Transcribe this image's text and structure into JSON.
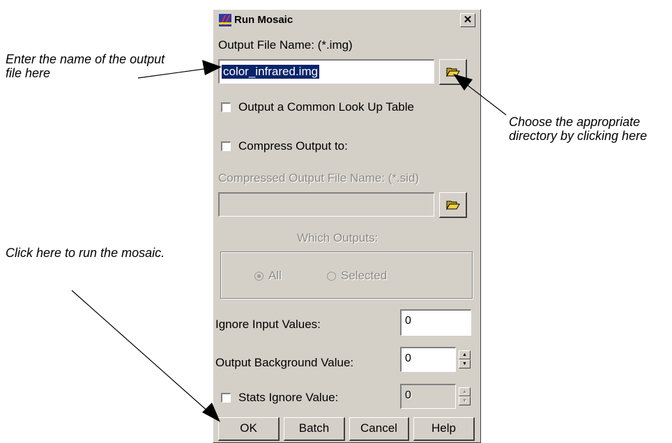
{
  "annotations": {
    "output_file": "Enter the name of the output file here",
    "directory": "Choose the appropriate directory by clicking here",
    "run": "Click here to run the mosaic."
  },
  "dialog": {
    "title": "Run Mosaic",
    "close_label": "✕",
    "output_label": "Output File Name: (*.img)",
    "output_value": "color_infrared.img",
    "common_lut_label": "Output a Common Look Up Table",
    "compress_label": "Compress Output to:",
    "compressed_label": "Compressed Output File Name: (*.sid)",
    "which_outputs_label": "Which Outputs:",
    "radio_all": "All",
    "radio_selected": "Selected",
    "ignore_input_label": "Ignore Input Values:",
    "ignore_input_value": "0",
    "bg_label": "Output Background Value:",
    "bg_value": "0",
    "stats_ignore_label": "Stats Ignore Value:",
    "stats_ignore_value": "0",
    "buttons": {
      "ok": "OK",
      "batch": "Batch",
      "cancel": "Cancel",
      "help": "Help"
    }
  },
  "colors": {
    "dialog_bg": "#d4d0c8",
    "selection": "#0a246a"
  },
  "icons": {
    "app": "mosaic-app-icon",
    "folder": "folder-open-icon"
  }
}
